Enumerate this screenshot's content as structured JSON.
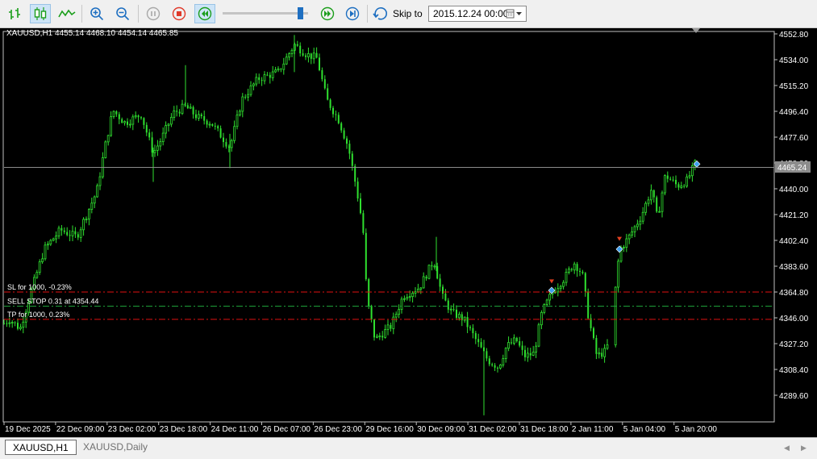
{
  "toolbar": {
    "skip_label": "Skip to",
    "date_value": "2015.12.24 00:00",
    "buttons": [
      "bar-chart",
      "candlestick-chart",
      "line-chart",
      "zoom-in",
      "zoom-out",
      "pause",
      "stop",
      "step-backward",
      "step-forward",
      "skip-to-end",
      "skip-to"
    ]
  },
  "chart": {
    "header": "XAUUSD,H1  4455.14 4468.10 4454.14 4465.85",
    "current_price": "4465.24",
    "price_labels": [
      "4552.80",
      "4534.00",
      "4515.20",
      "4496.40",
      "4477.60",
      "4458.80",
      "4440.00",
      "4421.20",
      "4402.40",
      "4383.60",
      "4364.80",
      "4346.00",
      "4327.20",
      "4308.40",
      "4289.60"
    ],
    "time_labels": [
      "19 Dec 2025",
      "22 Dec 09:00",
      "23 Dec 02:00",
      "23 Dec 18:00",
      "24 Dec 11:00",
      "26 Dec 07:00",
      "26 Dec 23:00",
      "29 Dec 16:00",
      "30 Dec 09:00",
      "31 Dec 02:00",
      "31 Dec 18:00",
      "2 Jan 11:00",
      "5 Jan 04:00",
      "5 Jan 20:00"
    ],
    "order_lines": [
      {
        "label": "SL for 1000, -0.23%",
        "price": 4364.8,
        "color": "#e01010"
      },
      {
        "label": "SELL STOP 0.31 at 4354.44",
        "price": 4354.44,
        "color": "#1fa83c"
      },
      {
        "label": "TP for 1000, 0.23%",
        "price": 4344.9,
        "color": "#e01010"
      }
    ],
    "colors": {
      "candle": "#2fe02f",
      "background": "#000000",
      "axis_text": "#ffffff",
      "price_line": "#8c8c8c"
    }
  },
  "tabs": [
    {
      "label": "XAUUSD,H1",
      "active": true
    },
    {
      "label": "XAUUSD,Daily",
      "active": false
    }
  ]
}
